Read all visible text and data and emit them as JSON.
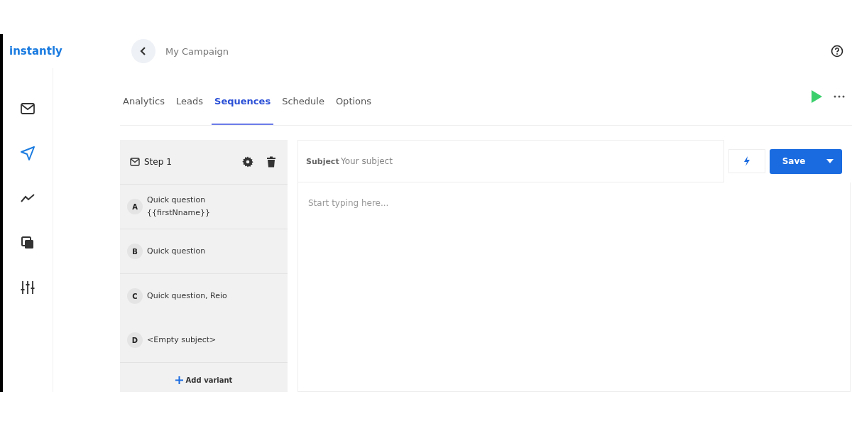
{
  "logo": "instantly",
  "header": {
    "title": "My Campaign"
  },
  "sidebar": {
    "items": [
      {
        "kind": "mail",
        "selected": false
      },
      {
        "kind": "send",
        "selected": true
      },
      {
        "kind": "trend",
        "selected": false
      },
      {
        "kind": "copy",
        "selected": false
      },
      {
        "kind": "sliders",
        "selected": false
      }
    ]
  },
  "tabs": [
    {
      "label": "Analytics",
      "selected": false
    },
    {
      "label": "Leads",
      "selected": false
    },
    {
      "label": "Sequences",
      "selected": true
    },
    {
      "label": "Schedule",
      "selected": false
    },
    {
      "label": "Options",
      "selected": false
    }
  ],
  "step": {
    "title": "Step 1",
    "variants": [
      {
        "letter": "A",
        "subject": "Quick question {{firstNname}}"
      },
      {
        "letter": "B",
        "subject": "Quick question"
      },
      {
        "letter": "C",
        "subject": "Quick question, Reio"
      },
      {
        "letter": "D",
        "subject": "<Empty subject>"
      }
    ],
    "add_label": "Add variant"
  },
  "editor": {
    "subject_label": "Subject",
    "subject_placeholder": "Your subject",
    "body_placeholder": "Start typing here...",
    "save_label": "Save"
  }
}
